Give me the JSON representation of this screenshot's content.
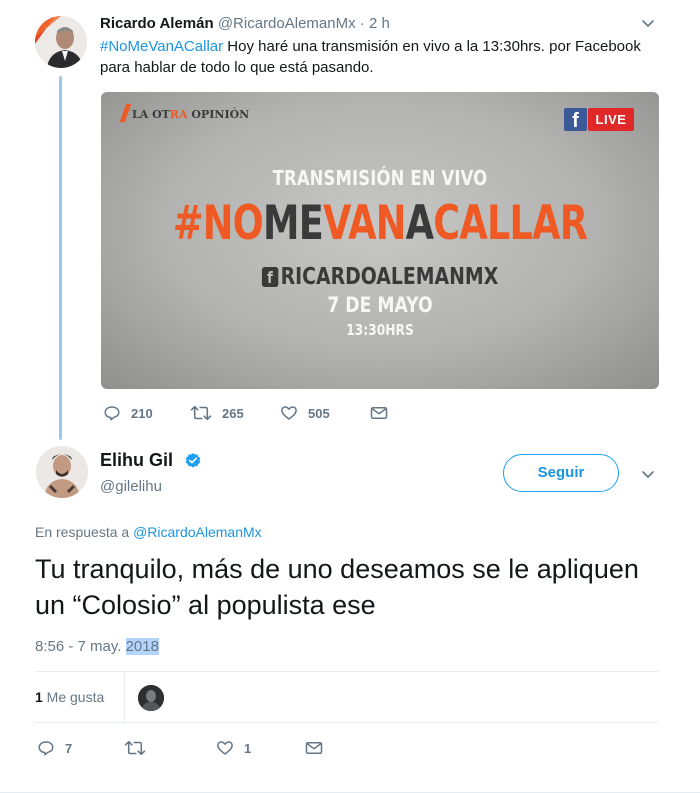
{
  "tweet1": {
    "name": "Ricardo Alemán",
    "handle": "@RicardoAlemanMx",
    "time": "· 2 h",
    "hashtag": "#NoMeVanACallar",
    "text": " Hoy haré una transmisión en vivo a la 13:30hrs. por Facebook para hablar de todo lo que está pasando.",
    "media": {
      "brand_pre": "LA OT",
      "brand_highlight": "RA",
      "brand_post": " OPINIÓN",
      "fb_letter": "f",
      "live": "LIVE",
      "subtitle": "TRANSMISIÓN EN VIVO",
      "title_parts": [
        "#NO",
        "ME",
        "VAN",
        "A",
        "CALLAR"
      ],
      "fb_handle_icon": "f",
      "fb_handle": "RICARDOALEMANMX",
      "date": "7 DE MAYO",
      "time": "13:30HRS"
    },
    "actions": {
      "replies": "210",
      "retweets": "265",
      "likes": "505"
    }
  },
  "tweet2": {
    "name": "Elihu Gil",
    "handle": "@gilelihu",
    "follow_label": "Seguir",
    "reply_prefix": "En respuesta a ",
    "reply_to": "@RicardoAlemanMx",
    "text": "Tu tranquilo, más de uno deseamos se le apliquen un “Colosio” al populista ese",
    "timestamp_prefix": "8:56 - 7 may. ",
    "timestamp_year": "2018",
    "likes_count": "1",
    "likes_label": " Me gusta",
    "actions": {
      "replies": "7",
      "retweets": "",
      "likes": "1"
    }
  },
  "colors": {
    "accent": "#1da1f2",
    "link": "#1b95e0",
    "muted": "#657786",
    "orange": "#ef5a24",
    "thread": "#9fc8e8"
  }
}
